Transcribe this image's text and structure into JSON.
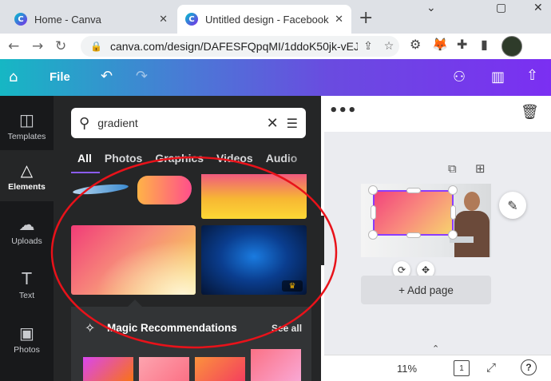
{
  "browser": {
    "tabs": [
      {
        "title": "Home - Canva",
        "favicon": "canva-icon"
      },
      {
        "title": "Untitled design - Facebook Co",
        "favicon": "canva-icon",
        "active": true
      }
    ],
    "url": "canva.com/design/DAFESFQpqMI/1ddoK50jk-vEJ...",
    "window_controls": {
      "minimize": "⌄",
      "restore": "▢",
      "close": "✕"
    }
  },
  "header": {
    "file_label": "File"
  },
  "rail": {
    "items": [
      {
        "label": "Templates",
        "icon": "templates-icon",
        "glyph": "◫"
      },
      {
        "label": "Elements",
        "icon": "elements-icon",
        "glyph": "△",
        "active": true
      },
      {
        "label": "Uploads",
        "icon": "uploads-icon",
        "glyph": "☁"
      },
      {
        "label": "Text",
        "icon": "text-icon",
        "glyph": "T"
      },
      {
        "label": "Photos",
        "icon": "photos-icon",
        "glyph": "▣"
      }
    ]
  },
  "panel": {
    "search": {
      "value": "gradient"
    },
    "tabs": [
      {
        "label": "All",
        "selected": true
      },
      {
        "label": "Photos"
      },
      {
        "label": "Graphics"
      },
      {
        "label": "Videos"
      },
      {
        "label": "Audio"
      }
    ],
    "magic": {
      "title": "Magic Recommendations",
      "see_all": "See all"
    }
  },
  "editor": {
    "add_page": "+ Add page",
    "zoom": "11%",
    "page_count": "1",
    "help": "?"
  },
  "colors": {
    "accent": "#8b3dff",
    "annotation": "#e8121a",
    "rail_bg": "#18191b",
    "panel_bg": "#252627"
  }
}
